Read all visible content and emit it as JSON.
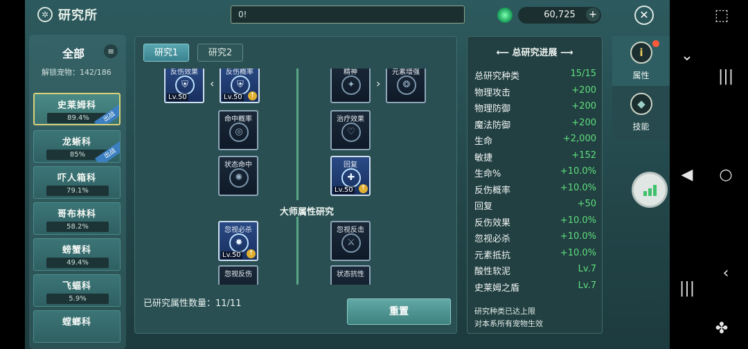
{
  "header": {
    "title": "研究所",
    "message_value": "0!",
    "currency": "60,725",
    "plus": "+",
    "close": "✕"
  },
  "sidebar": {
    "title": "全部",
    "menu": "≡",
    "unlocked": "解锁宠物：142/186",
    "families": [
      {
        "name": "史莱姆科",
        "progress": "89.4%",
        "tag": "出战",
        "active": true
      },
      {
        "name": "龙蜥科",
        "progress": "85%",
        "tag": "出战",
        "active": false
      },
      {
        "name": "吓人箱科",
        "progress": "79.1%",
        "tag": "",
        "active": false
      },
      {
        "name": "哥布林科",
        "progress": "58.2%",
        "tag": "",
        "active": false
      },
      {
        "name": "螃蟹科",
        "progress": "49.4%",
        "tag": "",
        "active": false
      },
      {
        "name": "飞蝠科",
        "progress": "5.9%",
        "tag": "",
        "active": false
      },
      {
        "name": "螳螂科",
        "progress": "",
        "tag": "",
        "active": false
      }
    ]
  },
  "research": {
    "tabs": [
      "研究1",
      "研究2"
    ],
    "master_title": "大师属性研究",
    "nodes": {
      "n1": {
        "label": "反伤效果",
        "lv": "Lv.50"
      },
      "n2": {
        "label": "反伤概率",
        "lv": "Lv.50"
      },
      "n3": {
        "label": "精神",
        "lv": ""
      },
      "n4": {
        "label": "元素增强",
        "lv": ""
      },
      "n5": {
        "label": "命中概率",
        "lv": ""
      },
      "n6": {
        "label": "治疗效果",
        "lv": ""
      },
      "n7": {
        "label": "状态命中",
        "lv": ""
      },
      "n8": {
        "label": "回复",
        "lv": "Lv.50"
      },
      "n9": {
        "label": "忽视必杀",
        "lv": "Lv.50"
      },
      "n10": {
        "label": "忽视反击",
        "lv": ""
      },
      "n11": {
        "label": "忽视反伤",
        "lv": ""
      },
      "n12": {
        "label": "状态抗性",
        "lv": ""
      }
    },
    "researched_count": "已研究属性数量：11/11",
    "reset_label": "重置"
  },
  "stats": {
    "title": "总研究进展",
    "rows": [
      {
        "k": "总研究种类",
        "v": "15/15"
      },
      {
        "k": "物理攻击",
        "v": "+200"
      },
      {
        "k": "物理防御",
        "v": "+200"
      },
      {
        "k": "魔法防御",
        "v": "+200"
      },
      {
        "k": "生命",
        "v": "+2,000"
      },
      {
        "k": "敏捷",
        "v": "+152"
      },
      {
        "k": "生命%",
        "v": "+10.0%"
      },
      {
        "k": "反伤概率",
        "v": "+10.0%"
      },
      {
        "k": "回复",
        "v": "+50"
      },
      {
        "k": "反伤效果",
        "v": "+10.0%"
      },
      {
        "k": "忽视必杀",
        "v": "+10.0%"
      },
      {
        "k": "元素抵抗",
        "v": "+10.0%"
      },
      {
        "k": "酸性软泥",
        "v": "Lv.7"
      },
      {
        "k": "史莱姆之盾",
        "v": "Lv.7"
      }
    ],
    "note1": "研究种类已达上限",
    "note2": "对本系所有宠物生效"
  },
  "right_tabs": [
    {
      "label": "属性",
      "icon": "i"
    },
    {
      "label": "技能",
      "icon": "◆"
    }
  ],
  "colors": {
    "accent_green": "#5fe07c",
    "gold": "#d9d27a"
  }
}
